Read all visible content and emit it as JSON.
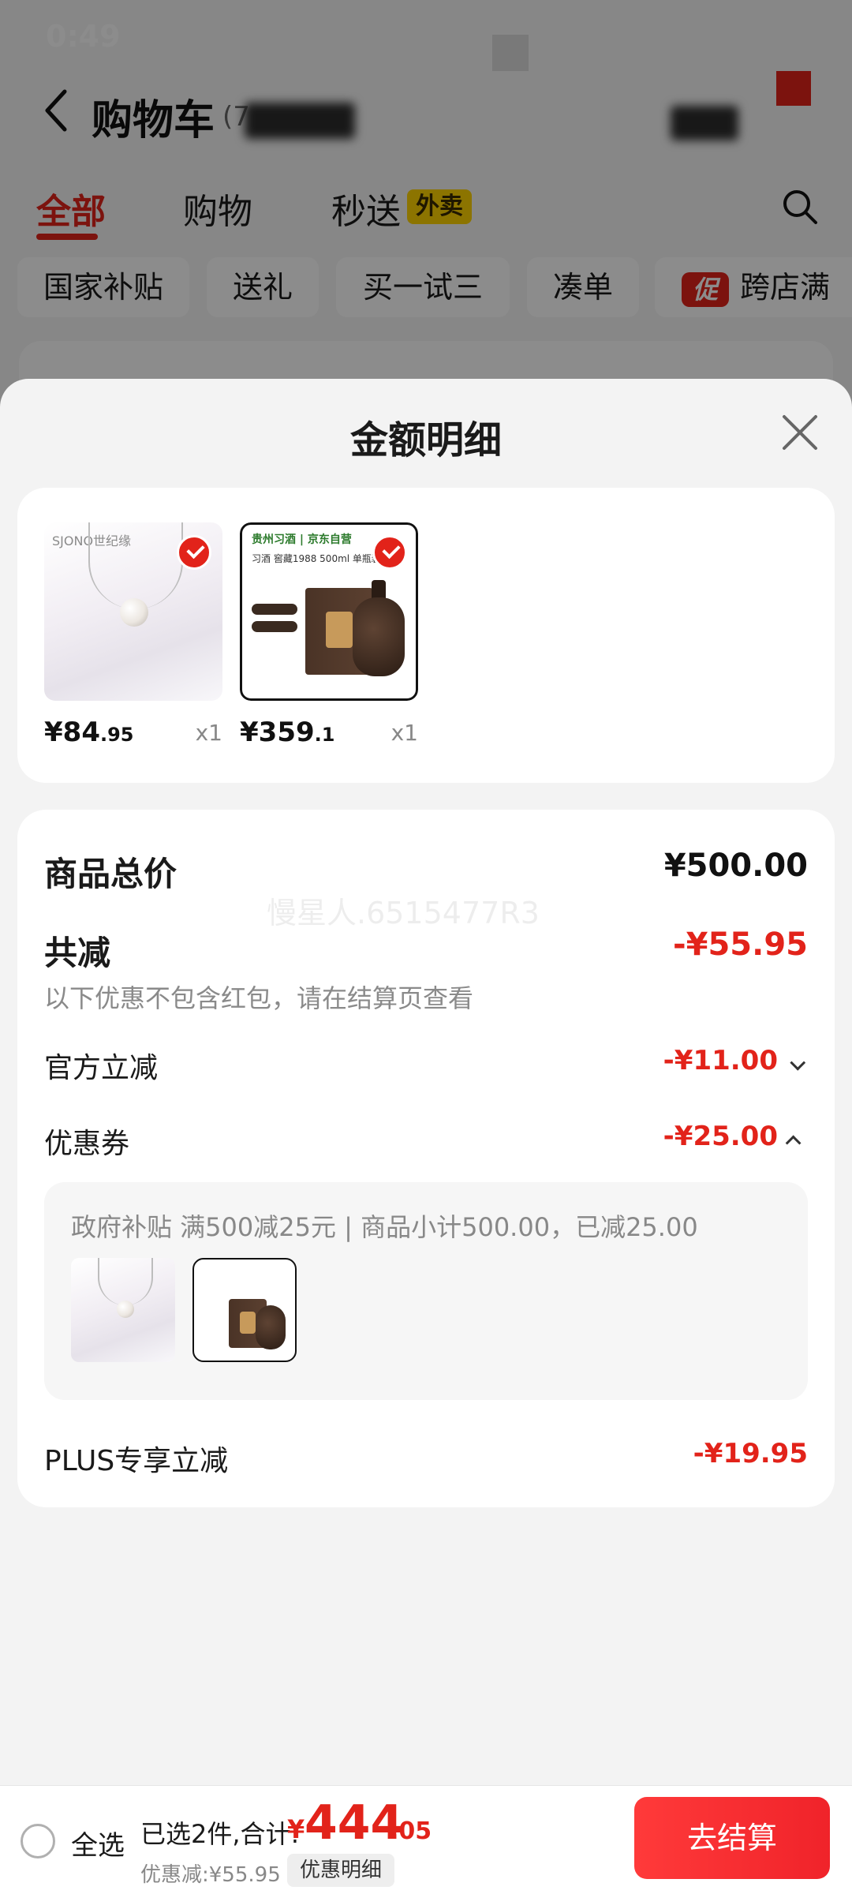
{
  "status": {
    "time": "0:49"
  },
  "nav": {
    "title": "购物车",
    "count_prefix": "(7"
  },
  "tabs": [
    {
      "label": "全部",
      "active": true
    },
    {
      "label": "购物",
      "active": false
    },
    {
      "label": "秒送",
      "active": false
    }
  ],
  "takeout_badge": "外卖",
  "filter_chips": [
    "国家补贴",
    "送礼",
    "买一试三",
    "凑单",
    "跨店满"
  ],
  "promo_badge": "促",
  "sheet": {
    "title": "金额明细",
    "products": [
      {
        "brand": "SJONO世纪缘",
        "price_int": "¥84",
        "price_dec": ".95",
        "qty": "x1",
        "checked": true
      },
      {
        "brand": "贵州习酒 | 京东自营",
        "name": "习酒 窖藏1988 500ml 单瓶装",
        "price_int": "¥359",
        "price_dec": ".1",
        "qty": "x1",
        "checked": true
      }
    ],
    "summary": {
      "total_label": "商品总价",
      "total_value": "¥500.00",
      "watermark": "慢星人.6515477R3",
      "reduce_label": "共减",
      "reduce_value": "-¥55.95",
      "note": "以下优惠不包含红包，请在结算页查看",
      "official_label": "官方立减",
      "official_value": "-¥11.00",
      "coupon_label": "优惠券",
      "coupon_value": "-¥25.00",
      "coupon_detail": "政府补贴 满500减25元 | 商品小计500.00，已减25.00",
      "plus_label": "PLUS专享立减",
      "plus_value": "-¥19.95"
    }
  },
  "bottom": {
    "select_all": "全选",
    "selected_text": "已选2件,合计:",
    "total_yen": "¥",
    "total_int": "444",
    "total_dec": ".05",
    "discount_text": "优惠减:¥55.95",
    "detail_btn": "优惠明细",
    "checkout": "去结算"
  },
  "colors": {
    "accent": "#e2231a",
    "badge": "#ffd400"
  }
}
